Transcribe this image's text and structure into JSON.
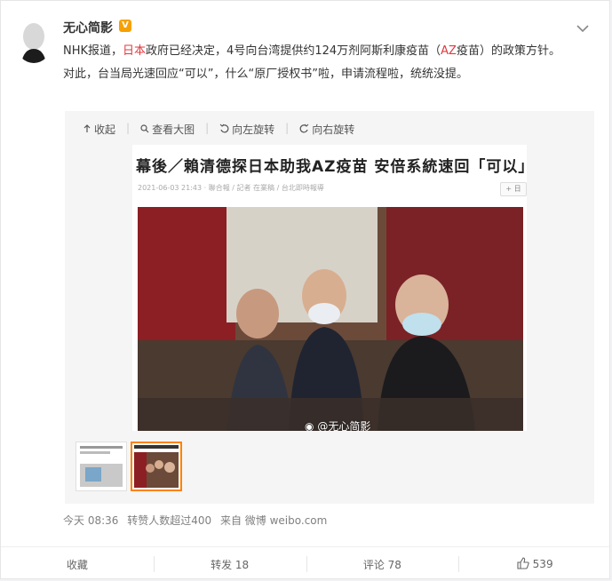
{
  "post": {
    "author": "无心简影",
    "verified_badge": "V",
    "text_line1_a": "NHK报道，",
    "text_line1_hl1": "日本",
    "text_line1_b": "政府已经决定，4号向台湾提供约124万剂阿斯利康疫苗（",
    "text_line1_hl2": "AZ",
    "text_line1_c": "疫苗）的政策方针。",
    "text_line2": "对此，台当局光速回应“可以”，什么“原厂授权书”啦，申请流程啦，统统没提。",
    "highlight_color": "#e0383e"
  },
  "gallery": {
    "collapse_label": "收起",
    "view_large_label": "查看大图",
    "rotate_left_label": "向左旋转",
    "rotate_right_label": "向右旋转",
    "headline": "幕後／賴清德探日本助我AZ疫苗 安倍系統速回「可以」",
    "meta": "2021-06-03 21:43 · 聯合報 / 記者 在業稿 / 台北即時報導",
    "plus_label": "+ 日",
    "watermark": "@无心简影"
  },
  "footer": {
    "time": "今天 08:36",
    "repost_note": "转赞人数超过400",
    "source": "来自 微博 weibo.com"
  },
  "actions": {
    "favorite": "收藏",
    "repost": "转发 18",
    "comment": "评论 78",
    "like": "539"
  },
  "icons": [
    "chevron-down-icon",
    "collapse-icon",
    "search-icon",
    "rotate-left-icon",
    "rotate-right-icon",
    "like-icon",
    "weibo-icon"
  ]
}
